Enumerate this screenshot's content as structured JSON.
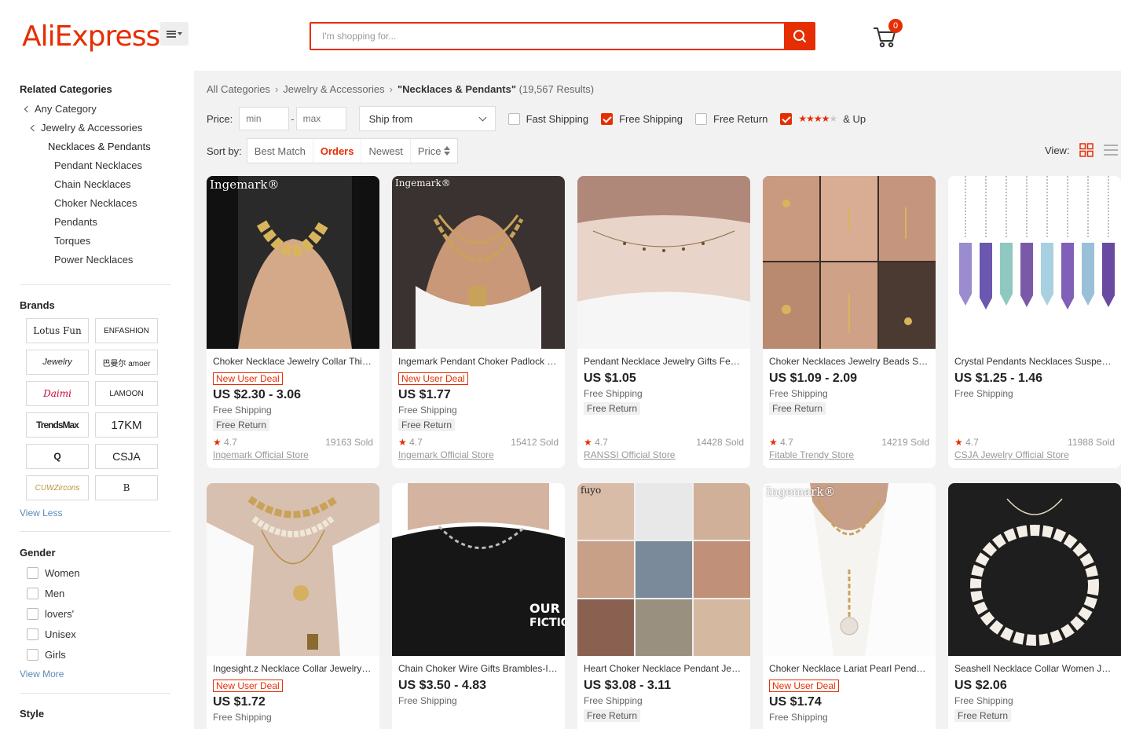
{
  "header": {
    "logo": "AliExpress",
    "logo_tm": "™",
    "search_placeholder": "I'm shopping for...",
    "cart_count": "0"
  },
  "sidebar": {
    "related_title": "Related Categories",
    "categories": [
      {
        "label": "Any Category"
      },
      {
        "label": "Jewelry & Accessories"
      },
      {
        "label": "Necklaces & Pendants"
      },
      {
        "label": "Pendant Necklaces"
      },
      {
        "label": "Chain Necklaces"
      },
      {
        "label": "Choker Necklaces"
      },
      {
        "label": "Pendants"
      },
      {
        "label": "Torques"
      },
      {
        "label": "Power Necklaces"
      }
    ],
    "brands_title": "Brands",
    "brands": [
      "Lotus Fun",
      "ENFASHION",
      "Jewelry",
      "巴曼尔 amoer",
      "Daimi",
      "LAMOON",
      "TrendsMax",
      "17KM",
      "Q",
      "CSJA",
      "CUWZircons",
      "B"
    ],
    "view_less": "View Less",
    "gender_title": "Gender",
    "genders": [
      "Women",
      "Men",
      "lovers'",
      "Unisex",
      "Girls"
    ],
    "view_more": "View More",
    "style_title": "Style"
  },
  "breadcrumb": {
    "all": "All Categories",
    "parent": "Jewelry & Accessories",
    "current": "\"Necklaces & Pendants\"",
    "results": "(19,567 Results)"
  },
  "filters": {
    "price_label": "Price:",
    "min_placeholder": "min",
    "max_placeholder": "max",
    "ship_from": "Ship from",
    "fast_shipping": "Fast Shipping",
    "free_shipping": "Free Shipping",
    "free_return": "Free Return",
    "rating_suffix": "& Up",
    "rating_stars": 4
  },
  "sort": {
    "label": "Sort by:",
    "options": [
      "Best Match",
      "Orders",
      "Newest",
      "Price"
    ],
    "active": "Orders"
  },
  "view": {
    "label": "View:"
  },
  "products": [
    {
      "title": "Choker Necklace Jewelry Collar Thick...",
      "new_user_deal": "New User Deal",
      "price": "US $2.30 - 3.06",
      "shipping": "Free Shipping",
      "free_return": "Free Return",
      "rating": "4.7",
      "sold": "19163 Sold",
      "store": "Ingemark Official Store",
      "img_brand": "Ingemark®"
    },
    {
      "title": "Ingemark Pendant Choker Padlock Necklace",
      "new_user_deal": "New User Deal",
      "price": "US $1.77",
      "shipping": "Free Shipping",
      "free_return": "Free Return",
      "rating": "4.7",
      "sold": "15412 Sold",
      "store": "Ingemark Official Store",
      "img_brand": "Ingemark®"
    },
    {
      "title": "Pendant Necklace Jewelry Gifts Female...",
      "new_user_deal": "",
      "price": "US $1.05",
      "shipping": "Free Shipping",
      "free_return": "Free Return",
      "rating": "4.7",
      "sold": "14428 Sold",
      "store": "RANSSI Official Store",
      "img_brand": ""
    },
    {
      "title": "Choker Necklaces Jewelry Beads Star...",
      "new_user_deal": "",
      "price": "US $1.09 - 2.09",
      "shipping": "Free Shipping",
      "free_return": "Free Return",
      "rating": "4.7",
      "sold": "14219 Sold",
      "store": "Fitable Trendy Store",
      "img_brand": ""
    },
    {
      "title": "Crystal Pendants Necklaces Suspension...",
      "new_user_deal": "",
      "price": "US $1.25 - 1.46",
      "shipping": "Free Shipping",
      "free_return": "",
      "rating": "4.7",
      "sold": "11988 Sold",
      "store": "CSJA Jewelry Official Store",
      "img_brand": ""
    },
    {
      "title": "Ingesight.z Necklace Collar Jewelry Coin",
      "new_user_deal": "New User Deal",
      "price": "US $1.72",
      "shipping": "Free Shipping",
      "free_return": "",
      "rating": "",
      "sold": "",
      "store": "",
      "img_brand": ""
    },
    {
      "title": "Chain Choker Wire Gifts Brambles-Iron...",
      "new_user_deal": "",
      "price": "US $3.50 - 4.83",
      "shipping": "Free Shipping",
      "free_return": "",
      "rating": "",
      "sold": "",
      "store": "",
      "img_brand": ""
    },
    {
      "title": "Heart Choker Necklace Pendant Jewelry",
      "new_user_deal": "",
      "price": "US $3.08 - 3.11",
      "shipping": "Free Shipping",
      "free_return": "Free Return",
      "rating": "",
      "sold": "",
      "store": "",
      "img_brand": "fuyo"
    },
    {
      "title": "Choker Necklace Lariat Pearl Pendant...",
      "new_user_deal": "New User Deal",
      "price": "US $1.74",
      "shipping": "Free Shipping",
      "free_return": "",
      "rating": "",
      "sold": "",
      "store": "",
      "img_brand": "Ingemark®"
    },
    {
      "title": "Seashell Necklace Collar Women Jewelry",
      "new_user_deal": "",
      "price": "US $2.06",
      "shipping": "Free Shipping",
      "free_return": "Free Return",
      "rating": "",
      "sold": "",
      "store": "",
      "img_brand": ""
    }
  ],
  "colors": {
    "accent": "#e62e04",
    "background": "#f2f2f2",
    "link": "#5a8bb8"
  }
}
